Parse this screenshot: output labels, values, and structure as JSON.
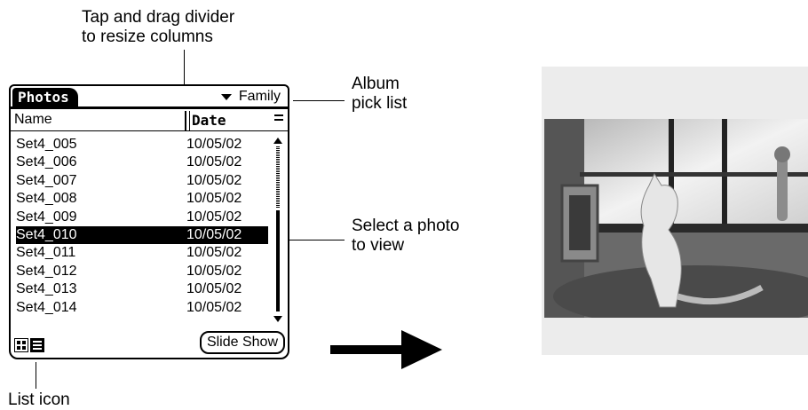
{
  "callouts": {
    "divider": [
      "Tap and drag divider",
      "to resize columns"
    ],
    "album": [
      "Album",
      "pick list"
    ],
    "select": [
      "Select a photo",
      "to view"
    ],
    "list_icon": "List icon"
  },
  "app": {
    "tab_title": "Photos",
    "album_value": "Family",
    "columns": {
      "name": "Name",
      "date": "Date"
    },
    "rows": [
      {
        "name": "Set4_005",
        "date": "10/05/02"
      },
      {
        "name": "Set4_006",
        "date": "10/05/02"
      },
      {
        "name": "Set4_007",
        "date": "10/05/02"
      },
      {
        "name": "Set4_008",
        "date": "10/05/02"
      },
      {
        "name": "Set4_009",
        "date": "10/05/02"
      },
      {
        "name": "Set4_010",
        "date": "10/05/02",
        "selected": true
      },
      {
        "name": "Set4_011",
        "date": "10/05/02"
      },
      {
        "name": "Set4_012",
        "date": "10/05/02"
      },
      {
        "name": "Set4_013",
        "date": "10/05/02"
      },
      {
        "name": "Set4_014",
        "date": "10/05/02"
      }
    ],
    "slide_show_label": "Slide Show",
    "icons": [
      "thumbnail-view-icon",
      "list-view-icon",
      "dropdown-triangle-icon",
      "sort-options-icon",
      "scroll-up-icon",
      "scroll-down-icon"
    ]
  }
}
